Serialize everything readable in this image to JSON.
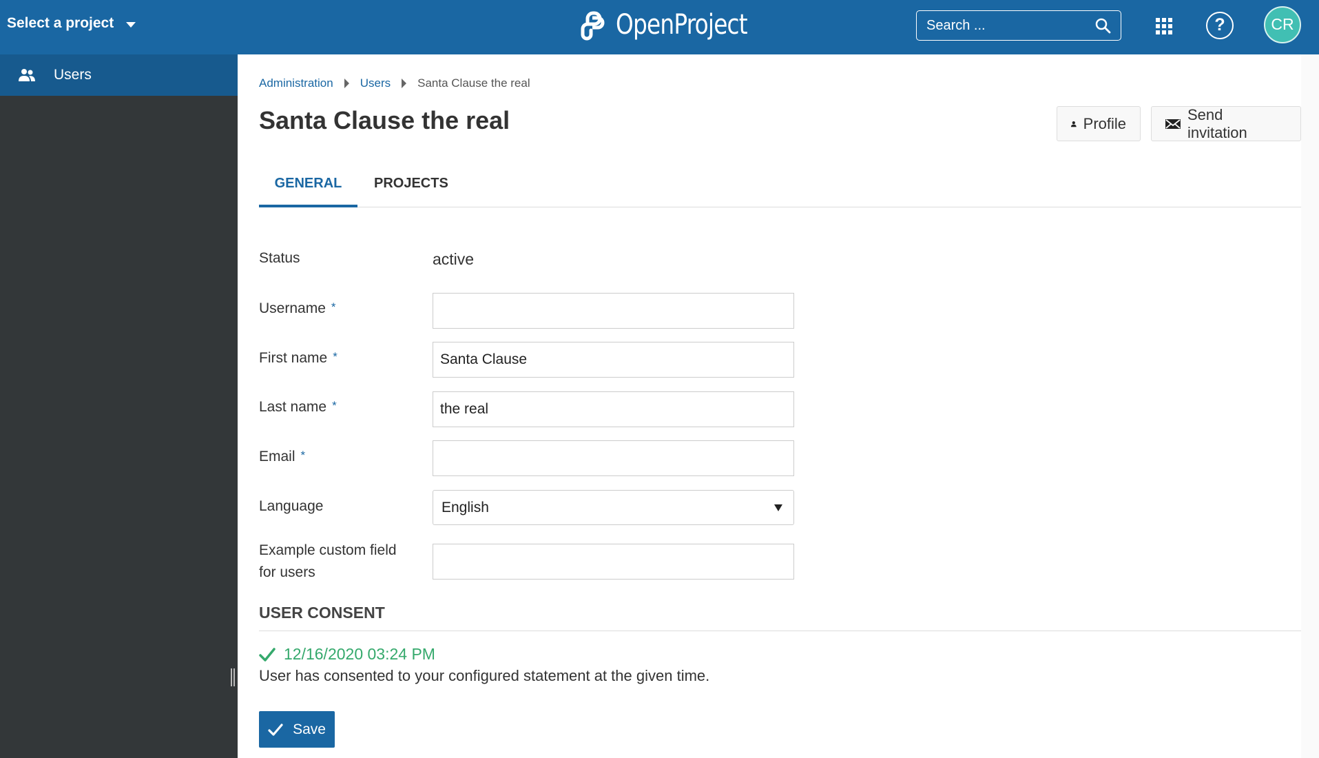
{
  "header": {
    "project_select_label": "Select a project",
    "logo_text": "OpenProject",
    "search_placeholder": "Search ...",
    "avatar_initials": "CR",
    "help_label": "?",
    "colors": {
      "header_bg": "#1A67A3",
      "avatar_bg": "#41BFB3"
    }
  },
  "sidebar": {
    "items": [
      {
        "label": "Users",
        "icon": "users-icon",
        "active": true
      }
    ]
  },
  "breadcrumb": {
    "items": [
      {
        "label": "Administration",
        "link": true
      },
      {
        "label": "Users",
        "link": true
      },
      {
        "label": "Santa Clause the real",
        "link": false
      }
    ]
  },
  "page": {
    "title": "Santa Clause the real",
    "actions": {
      "profile_label": "Profile",
      "send_invitation_label": "Send invitation"
    }
  },
  "tabs": [
    {
      "label": "GENERAL",
      "active": true
    },
    {
      "label": "PROJECTS",
      "active": false
    }
  ],
  "form": {
    "status": {
      "label": "Status",
      "value": "active"
    },
    "username": {
      "label": "Username",
      "required": "*",
      "value": ""
    },
    "first_name": {
      "label": "First name",
      "required": "*",
      "value": "Santa Clause"
    },
    "last_name": {
      "label": "Last name",
      "required": "*",
      "value": "the real"
    },
    "email": {
      "label": "Email",
      "required": "*",
      "value": ""
    },
    "language": {
      "label": "Language",
      "value": "English"
    },
    "custom_field": {
      "label_line1": "Example custom field",
      "label_line2": "for users",
      "value": ""
    }
  },
  "consent": {
    "section_title": "USER CONSENT",
    "date": "12/16/2020 03:24 PM",
    "text": "User has consented to your configured statement at the given time.",
    "colors": {
      "success": "#35A96C"
    }
  },
  "save_label": "Save"
}
